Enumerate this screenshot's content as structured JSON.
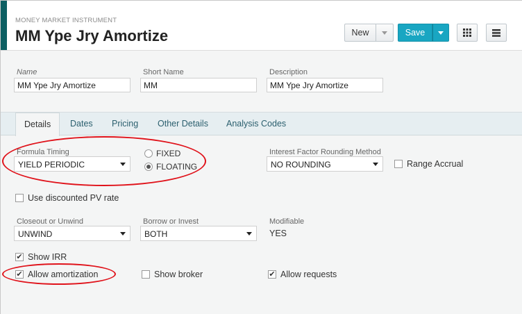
{
  "header": {
    "subtitle": "MONEY MARKET INSTRUMENT",
    "title": "MM Ype Jry Amortize",
    "new_label": "New",
    "save_label": "Save",
    "accent_color": "#0d5f62",
    "save_color": "#19a6c2"
  },
  "identity": {
    "name_label": "Name",
    "name_value": "MM Ype Jry Amortize",
    "short_name_label": "Short Name",
    "short_name_value": "MM",
    "description_label": "Description",
    "description_value": "MM Ype Jry Amortize"
  },
  "tabs": [
    {
      "label": "Details",
      "active": true
    },
    {
      "label": "Dates",
      "active": false
    },
    {
      "label": "Pricing",
      "active": false
    },
    {
      "label": "Other Details",
      "active": false
    },
    {
      "label": "Analysis Codes",
      "active": false
    }
  ],
  "details": {
    "formula_timing_label": "Formula Timing",
    "formula_timing_value": "YIELD PERIODIC",
    "fixed_label": "FIXED",
    "floating_label": "FLOATING",
    "rate_type_selected": "FLOATING",
    "rounding_label": "Interest Factor Rounding Method",
    "rounding_value": "NO ROUNDING",
    "range_accrual_label": "Range Accrual",
    "range_accrual_checked": false,
    "discounted_pv_label": "Use discounted PV rate",
    "discounted_pv_checked": false,
    "closeout_label": "Closeout or Unwind",
    "closeout_value": "UNWIND",
    "borrow_label": "Borrow or Invest",
    "borrow_value": "BOTH",
    "modifiable_label": "Modifiable",
    "modifiable_value": "YES",
    "show_irr_label": "Show IRR",
    "show_irr_checked": true,
    "allow_amortization_label": "Allow amortization",
    "allow_amortization_checked": true,
    "show_broker_label": "Show broker",
    "show_broker_checked": false,
    "allow_requests_label": "Allow requests",
    "allow_requests_checked": true
  },
  "check_mark": "✔",
  "annotation_color": "#e0121a"
}
